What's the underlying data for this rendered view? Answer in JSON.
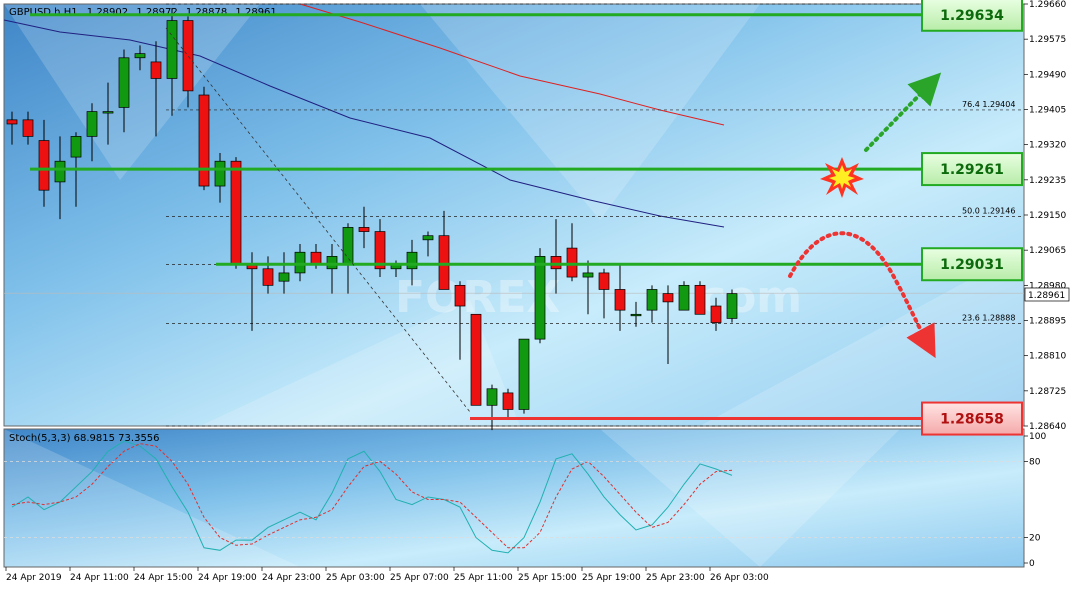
{
  "header": {
    "symbol": "GBPUSD.h,H1",
    "open": "1.28902",
    "high": "1.28972",
    "low": "1.28878",
    "close": "1.28961"
  },
  "stoch_label": "Stoch(5,3,3) 68.9815 73.3556",
  "watermark": "FOREX",
  "watermark2": "com",
  "colors": {
    "bull": "#119911",
    "bear": "#ee1111",
    "ma_slow": "#e02020",
    "ma_fast": "#202080",
    "green_line": "#22aa22",
    "red_line": "#ee3333",
    "stoch_main": "#20b0b0",
    "stoch_signal": "#e03030"
  },
  "chart_data": {
    "type": "candlestick",
    "ylim": [
      1.2864,
      1.2966
    ],
    "y_ticks": [
      "1.29660",
      "1.29575",
      "1.29490",
      "1.29405",
      "1.29320",
      "1.29235",
      "1.29150",
      "1.29065",
      "1.28980",
      "1.28895",
      "1.28810",
      "1.28725",
      "1.28640"
    ],
    "x_ticks": [
      "24 Apr 2019",
      "24 Apr 11:00",
      "24 Apr 15:00",
      "24 Apr 19:00",
      "24 Apr 23:00",
      "25 Apr 03:00",
      "25 Apr 07:00",
      "25 Apr 11:00",
      "25 Apr 15:00",
      "25 Apr 19:00",
      "25 Apr 23:00",
      "26 Apr 03:00"
    ],
    "current_price": "1.28961",
    "levels": [
      {
        "label": "1.29634",
        "value": 1.29634,
        "kind": "resistance"
      },
      {
        "label": "1.29261",
        "value": 1.29261,
        "kind": "resistance"
      },
      {
        "label": "1.29031",
        "value": 1.29031,
        "kind": "resistance"
      },
      {
        "label": "1.28658",
        "value": 1.28658,
        "kind": "support"
      }
    ],
    "fib_levels": [
      {
        "label": "76.4  1.29404",
        "value": 1.29404
      },
      {
        "label": "50.0  1.29146",
        "value": 1.29146
      },
      {
        "label": "23.6  1.28888",
        "value": 1.28888
      }
    ],
    "candles": [
      [
        1.2938,
        1.294,
        1.2932,
        1.2937
      ],
      [
        1.2938,
        1.294,
        1.2932,
        1.2934
      ],
      [
        1.2933,
        1.2938,
        1.2917,
        1.2921
      ],
      [
        1.2923,
        1.2934,
        1.2914,
        1.2928
      ],
      [
        1.2929,
        1.2935,
        1.2917,
        1.2934
      ],
      [
        1.2934,
        1.2942,
        1.2928,
        1.294
      ],
      [
        1.294,
        1.2947,
        1.2932,
        1.294
      ],
      [
        1.2941,
        1.2955,
        1.2935,
        1.2953
      ],
      [
        1.2953,
        1.2956,
        1.295,
        1.2954
      ],
      [
        1.2952,
        1.2957,
        1.2934,
        1.2948
      ],
      [
        1.2948,
        1.2965,
        1.2939,
        1.2962
      ],
      [
        1.2962,
        1.2963,
        1.2941,
        1.2945
      ],
      [
        1.2944,
        1.2946,
        1.2921,
        1.2922
      ],
      [
        1.2922,
        1.293,
        1.2918,
        1.2928
      ],
      [
        1.2928,
        1.2929,
        1.2902,
        1.2903
      ],
      [
        1.2903,
        1.2906,
        1.2887,
        1.2902
      ],
      [
        1.2902,
        1.2905,
        1.2896,
        1.2898
      ],
      [
        1.2899,
        1.2906,
        1.2896,
        1.2901
      ],
      [
        1.2901,
        1.2908,
        1.2899,
        1.2906
      ],
      [
        1.2906,
        1.2908,
        1.2902,
        1.2903
      ],
      [
        1.2902,
        1.2908,
        1.2896,
        1.2905
      ],
      [
        1.2903,
        1.2913,
        1.2896,
        1.2912
      ],
      [
        1.2912,
        1.2917,
        1.2907,
        1.2911
      ],
      [
        1.2911,
        1.2914,
        1.29,
        1.2902
      ],
      [
        1.2902,
        1.2904,
        1.29,
        1.2903
      ],
      [
        1.2902,
        1.2909,
        1.2898,
        1.2906
      ],
      [
        1.2909,
        1.2911,
        1.2905,
        1.291
      ],
      [
        1.291,
        1.2916,
        1.2897,
        1.2897
      ],
      [
        1.2898,
        1.2899,
        1.288,
        1.2893
      ],
      [
        1.2891,
        1.2891,
        1.2871,
        1.2869
      ],
      [
        1.2869,
        1.2874,
        1.2863,
        1.2873
      ],
      [
        1.2872,
        1.2873,
        1.2866,
        1.2868
      ],
      [
        1.2868,
        1.2885,
        1.2867,
        1.2885
      ],
      [
        1.2885,
        1.2907,
        1.2884,
        1.2905
      ],
      [
        1.2905,
        1.2914,
        1.2896,
        1.2902
      ],
      [
        1.2907,
        1.2913,
        1.2899,
        1.29
      ],
      [
        1.29,
        1.2904,
        1.2891,
        1.2901
      ],
      [
        1.2901,
        1.2902,
        1.289,
        1.2897
      ],
      [
        1.2897,
        1.2903,
        1.2887,
        1.2892
      ],
      [
        1.2891,
        1.2894,
        1.2888,
        1.2891
      ],
      [
        1.2892,
        1.2898,
        1.2889,
        1.2897
      ],
      [
        1.2896,
        1.2898,
        1.2879,
        1.2894
      ],
      [
        1.2892,
        1.2899,
        1.2892,
        1.2898
      ],
      [
        1.2898,
        1.2899,
        1.2891,
        1.2891
      ],
      [
        1.2893,
        1.2895,
        1.2887,
        1.2889
      ],
      [
        1.289,
        1.2897,
        1.2889,
        1.2896
      ]
    ],
    "stoch_ylim": [
      0,
      100
    ],
    "stoch_ticks": [
      "100",
      "80",
      "20",
      "0"
    ],
    "stoch_main": [
      44,
      52,
      42,
      48,
      60,
      72,
      88,
      96,
      92,
      82,
      60,
      40,
      12,
      10,
      18,
      18,
      28,
      34,
      40,
      34,
      55,
      82,
      88,
      72,
      50,
      46,
      52,
      50,
      44,
      20,
      10,
      8,
      20,
      48,
      82,
      86,
      70,
      52,
      38,
      26,
      30,
      44,
      62,
      78,
      74,
      69
    ],
    "stoch_signal": [
      46,
      48,
      46,
      48,
      52,
      62,
      76,
      88,
      94,
      92,
      80,
      62,
      36,
      20,
      14,
      15,
      22,
      28,
      34,
      36,
      42,
      60,
      76,
      80,
      70,
      56,
      50,
      50,
      48,
      36,
      24,
      12,
      12,
      24,
      52,
      74,
      80,
      68,
      54,
      40,
      28,
      32,
      46,
      62,
      72,
      73
    ]
  }
}
